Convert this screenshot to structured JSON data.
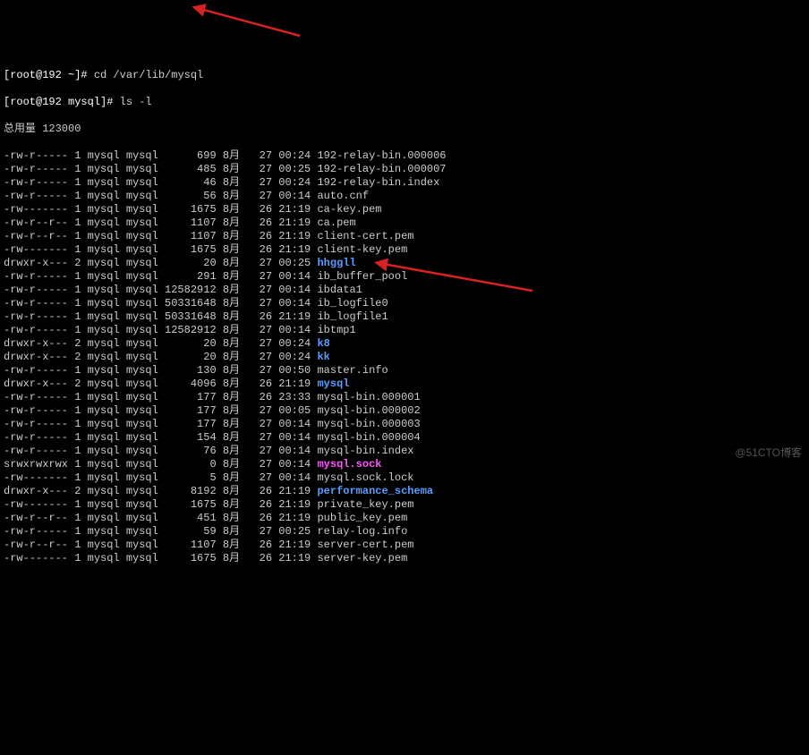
{
  "prompts": {
    "p1_user": "[root@192 ~]# ",
    "p1_cmd": "cd /var/lib/mysql",
    "p2_user": "[root@192 mysql]# ",
    "p2_cmd": "ls -l"
  },
  "total_line": "总用量 123000",
  "rows": [
    {
      "perm": "-rw-r-----",
      "lnk": "1",
      "own": "mysql",
      "grp": "mysql",
      "size": "699",
      "mon": "8月",
      "day": "27",
      "time": "00:24",
      "name": "192-relay-bin.000006",
      "cls": ""
    },
    {
      "perm": "-rw-r-----",
      "lnk": "1",
      "own": "mysql",
      "grp": "mysql",
      "size": "485",
      "mon": "8月",
      "day": "27",
      "time": "00:25",
      "name": "192-relay-bin.000007",
      "cls": ""
    },
    {
      "perm": "-rw-r-----",
      "lnk": "1",
      "own": "mysql",
      "grp": "mysql",
      "size": "46",
      "mon": "8月",
      "day": "27",
      "time": "00:24",
      "name": "192-relay-bin.index",
      "cls": ""
    },
    {
      "perm": "-rw-r-----",
      "lnk": "1",
      "own": "mysql",
      "grp": "mysql",
      "size": "56",
      "mon": "8月",
      "day": "27",
      "time": "00:14",
      "name": "auto.cnf",
      "cls": ""
    },
    {
      "perm": "-rw-------",
      "lnk": "1",
      "own": "mysql",
      "grp": "mysql",
      "size": "1675",
      "mon": "8月",
      "day": "26",
      "time": "21:19",
      "name": "ca-key.pem",
      "cls": ""
    },
    {
      "perm": "-rw-r--r--",
      "lnk": "1",
      "own": "mysql",
      "grp": "mysql",
      "size": "1107",
      "mon": "8月",
      "day": "26",
      "time": "21:19",
      "name": "ca.pem",
      "cls": ""
    },
    {
      "perm": "-rw-r--r--",
      "lnk": "1",
      "own": "mysql",
      "grp": "mysql",
      "size": "1107",
      "mon": "8月",
      "day": "26",
      "time": "21:19",
      "name": "client-cert.pem",
      "cls": ""
    },
    {
      "perm": "-rw-------",
      "lnk": "1",
      "own": "mysql",
      "grp": "mysql",
      "size": "1675",
      "mon": "8月",
      "day": "26",
      "time": "21:19",
      "name": "client-key.pem",
      "cls": ""
    },
    {
      "perm": "drwxr-x---",
      "lnk": "2",
      "own": "mysql",
      "grp": "mysql",
      "size": "20",
      "mon": "8月",
      "day": "27",
      "time": "00:25",
      "name": "hhggll",
      "cls": "dircol"
    },
    {
      "perm": "-rw-r-----",
      "lnk": "1",
      "own": "mysql",
      "grp": "mysql",
      "size": "291",
      "mon": "8月",
      "day": "27",
      "time": "00:14",
      "name": "ib_buffer_pool",
      "cls": ""
    },
    {
      "perm": "-rw-r-----",
      "lnk": "1",
      "own": "mysql",
      "grp": "mysql",
      "size": "12582912",
      "mon": "8月",
      "day": "27",
      "time": "00:14",
      "name": "ibdata1",
      "cls": ""
    },
    {
      "perm": "-rw-r-----",
      "lnk": "1",
      "own": "mysql",
      "grp": "mysql",
      "size": "50331648",
      "mon": "8月",
      "day": "27",
      "time": "00:14",
      "name": "ib_logfile0",
      "cls": ""
    },
    {
      "perm": "-rw-r-----",
      "lnk": "1",
      "own": "mysql",
      "grp": "mysql",
      "size": "50331648",
      "mon": "8月",
      "day": "26",
      "time": "21:19",
      "name": "ib_logfile1",
      "cls": ""
    },
    {
      "perm": "-rw-r-----",
      "lnk": "1",
      "own": "mysql",
      "grp": "mysql",
      "size": "12582912",
      "mon": "8月",
      "day": "27",
      "time": "00:14",
      "name": "ibtmp1",
      "cls": ""
    },
    {
      "perm": "drwxr-x---",
      "lnk": "2",
      "own": "mysql",
      "grp": "mysql",
      "size": "20",
      "mon": "8月",
      "day": "27",
      "time": "00:24",
      "name": "k8",
      "cls": "dircol"
    },
    {
      "perm": "drwxr-x---",
      "lnk": "2",
      "own": "mysql",
      "grp": "mysql",
      "size": "20",
      "mon": "8月",
      "day": "27",
      "time": "00:24",
      "name": "kk",
      "cls": "dircol"
    },
    {
      "perm": "-rw-r-----",
      "lnk": "1",
      "own": "mysql",
      "grp": "mysql",
      "size": "130",
      "mon": "8月",
      "day": "27",
      "time": "00:50",
      "name": "master.info",
      "cls": ""
    },
    {
      "perm": "drwxr-x---",
      "lnk": "2",
      "own": "mysql",
      "grp": "mysql",
      "size": "4096",
      "mon": "8月",
      "day": "26",
      "time": "21:19",
      "name": "mysql",
      "cls": "dircol"
    },
    {
      "perm": "-rw-r-----",
      "lnk": "1",
      "own": "mysql",
      "grp": "mysql",
      "size": "177",
      "mon": "8月",
      "day": "26",
      "time": "23:33",
      "name": "mysql-bin.000001",
      "cls": ""
    },
    {
      "perm": "-rw-r-----",
      "lnk": "1",
      "own": "mysql",
      "grp": "mysql",
      "size": "177",
      "mon": "8月",
      "day": "27",
      "time": "00:05",
      "name": "mysql-bin.000002",
      "cls": ""
    },
    {
      "perm": "-rw-r-----",
      "lnk": "1",
      "own": "mysql",
      "grp": "mysql",
      "size": "177",
      "mon": "8月",
      "day": "27",
      "time": "00:14",
      "name": "mysql-bin.000003",
      "cls": ""
    },
    {
      "perm": "-rw-r-----",
      "lnk": "1",
      "own": "mysql",
      "grp": "mysql",
      "size": "154",
      "mon": "8月",
      "day": "27",
      "time": "00:14",
      "name": "mysql-bin.000004",
      "cls": ""
    },
    {
      "perm": "-rw-r-----",
      "lnk": "1",
      "own": "mysql",
      "grp": "mysql",
      "size": "76",
      "mon": "8月",
      "day": "27",
      "time": "00:14",
      "name": "mysql-bin.index",
      "cls": ""
    },
    {
      "perm": "srwxrwxrwx",
      "lnk": "1",
      "own": "mysql",
      "grp": "mysql",
      "size": "0",
      "mon": "8月",
      "day": "27",
      "time": "00:14",
      "name": "mysql.sock",
      "cls": "magenta"
    },
    {
      "perm": "-rw-------",
      "lnk": "1",
      "own": "mysql",
      "grp": "mysql",
      "size": "5",
      "mon": "8月",
      "day": "27",
      "time": "00:14",
      "name": "mysql.sock.lock",
      "cls": ""
    },
    {
      "perm": "drwxr-x---",
      "lnk": "2",
      "own": "mysql",
      "grp": "mysql",
      "size": "8192",
      "mon": "8月",
      "day": "26",
      "time": "21:19",
      "name": "performance_schema",
      "cls": "dircol"
    },
    {
      "perm": "-rw-------",
      "lnk": "1",
      "own": "mysql",
      "grp": "mysql",
      "size": "1675",
      "mon": "8月",
      "day": "26",
      "time": "21:19",
      "name": "private_key.pem",
      "cls": ""
    },
    {
      "perm": "-rw-r--r--",
      "lnk": "1",
      "own": "mysql",
      "grp": "mysql",
      "size": "451",
      "mon": "8月",
      "day": "26",
      "time": "21:19",
      "name": "public_key.pem",
      "cls": ""
    },
    {
      "perm": "-rw-r-----",
      "lnk": "1",
      "own": "mysql",
      "grp": "mysql",
      "size": "59",
      "mon": "8月",
      "day": "27",
      "time": "00:25",
      "name": "relay-log.info",
      "cls": ""
    },
    {
      "perm": "-rw-r--r--",
      "lnk": "1",
      "own": "mysql",
      "grp": "mysql",
      "size": "1107",
      "mon": "8月",
      "day": "26",
      "time": "21:19",
      "name": "server-cert.pem",
      "cls": ""
    },
    {
      "perm": "-rw-------",
      "lnk": "1",
      "own": "mysql",
      "grp": "mysql",
      "size": "1675",
      "mon": "8月",
      "day": "26",
      "time": "21:19",
      "name": "server-key.pem",
      "cls": ""
    }
  ],
  "watermark": "@51CTO博客"
}
